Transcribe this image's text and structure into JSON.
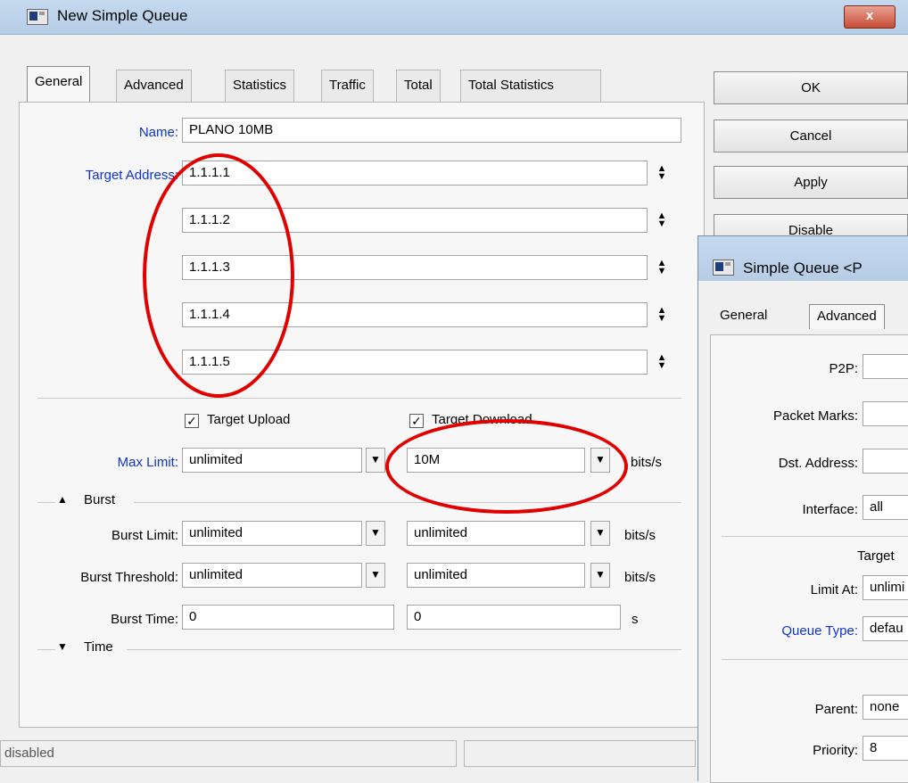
{
  "main_window": {
    "title": "New Simple Queue",
    "close_glyph": "x",
    "tabs": [
      {
        "label": "General"
      },
      {
        "label": "Advanced"
      },
      {
        "label": "Statistics"
      },
      {
        "label": "Traffic"
      },
      {
        "label": "Total"
      },
      {
        "label": "Total Statistics"
      }
    ],
    "name": {
      "label": "Name:",
      "value": "PLANO 10MB"
    },
    "target_address": {
      "label": "Target Address:",
      "values": [
        "1.1.1.1",
        "1.1.1.2",
        "1.1.1.3",
        "1.1.1.4",
        "1.1.1.5"
      ]
    },
    "target_upload": {
      "label": "Target Upload",
      "checked": true
    },
    "target_download": {
      "label": "Target Download",
      "checked": true
    },
    "max_limit": {
      "label": "Max Limit:",
      "upload": "unlimited",
      "download": "10M",
      "unit": "bits/s"
    },
    "burst_section": "Burst",
    "burst_limit": {
      "label": "Burst Limit:",
      "upload": "unlimited",
      "download": "unlimited",
      "unit": "bits/s"
    },
    "burst_threshold": {
      "label": "Burst Threshold:",
      "upload": "unlimited",
      "download": "unlimited",
      "unit": "bits/s"
    },
    "burst_time": {
      "label": "Burst Time:",
      "upload": "0",
      "download": "0",
      "unit": "s"
    },
    "time_section": "Time",
    "status": "disabled",
    "buttons": {
      "ok": "OK",
      "cancel": "Cancel",
      "apply": "Apply",
      "disable": "Disable"
    }
  },
  "second_window": {
    "title": "Simple Queue <P",
    "tabs": [
      {
        "label": "General"
      },
      {
        "label": "Advanced"
      }
    ],
    "p2p_label": "P2P:",
    "packet_marks_label": "Packet Marks:",
    "dst_address_label": "Dst. Address:",
    "interface": {
      "label": "Interface:",
      "value": "all"
    },
    "target_header": "Target",
    "limit_at": {
      "label": "Limit At:",
      "value": "unlimi"
    },
    "queue_type": {
      "label": "Queue Type:",
      "value": "defau"
    },
    "parent": {
      "label": "Parent:",
      "value": "none"
    },
    "priority": {
      "label": "Priority:",
      "value": "8"
    }
  },
  "colors": {
    "annotation": "#e10000",
    "link_label": "#1033d4",
    "titlebar": "#c5d9ee"
  }
}
